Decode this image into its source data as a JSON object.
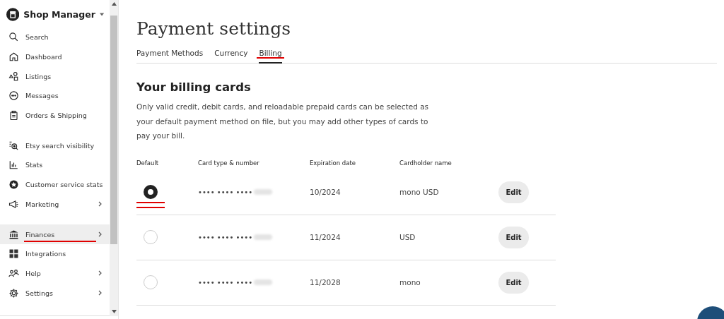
{
  "sidebar": {
    "title": "Shop Manager",
    "groups": [
      {
        "items": [
          {
            "label": "Search",
            "selected": false,
            "expandable": false,
            "marked": false
          },
          {
            "label": "Dashboard",
            "selected": false,
            "expandable": false,
            "marked": false
          },
          {
            "label": "Listings",
            "selected": false,
            "expandable": false,
            "marked": false
          },
          {
            "label": "Messages",
            "selected": false,
            "expandable": false,
            "marked": false
          },
          {
            "label": "Orders & Shipping",
            "selected": false,
            "expandable": false,
            "marked": false
          }
        ]
      },
      {
        "items": [
          {
            "label": "Etsy search visibility",
            "selected": false,
            "expandable": false,
            "marked": false
          },
          {
            "label": "Stats",
            "selected": false,
            "expandable": false,
            "marked": false
          },
          {
            "label": "Customer service stats",
            "selected": false,
            "expandable": false,
            "marked": false
          },
          {
            "label": "Marketing",
            "selected": false,
            "expandable": true,
            "marked": false
          }
        ]
      },
      {
        "items": [
          {
            "label": "Finances",
            "selected": true,
            "expandable": true,
            "marked": true
          },
          {
            "label": "Integrations",
            "selected": false,
            "expandable": false,
            "marked": false
          },
          {
            "label": "Help",
            "selected": false,
            "expandable": true,
            "marked": false
          },
          {
            "label": "Settings",
            "selected": false,
            "expandable": true,
            "marked": false
          }
        ]
      }
    ]
  },
  "page": {
    "title": "Payment settings",
    "tabs": [
      {
        "label": "Payment Methods",
        "selected": false,
        "marked": false
      },
      {
        "label": "Currency",
        "selected": false,
        "marked": false
      },
      {
        "label": "Billing",
        "selected": true,
        "marked": true
      }
    ],
    "heading": "Your billing cards",
    "description": "Only valid credit, debit cards, and reloadable prepaid cards can be selected as your default payment method on file, but you may add other types of cards to pay your bill.",
    "table": {
      "columns": [
        "Default",
        "Card type & number",
        "Expiration date",
        "Cardholder name"
      ],
      "rows": [
        {
          "selected": true,
          "marked": true,
          "card_number": "•••• •••• ••••",
          "expiration": "10/2024",
          "cardholder": "mono USD",
          "action": "Edit"
        },
        {
          "selected": false,
          "marked": false,
          "card_number": "•••• •••• ••••",
          "expiration": "11/2024",
          "cardholder": "USD",
          "action": "Edit"
        },
        {
          "selected": false,
          "marked": false,
          "card_number": "•••• •••• ••••",
          "expiration": "11/2028",
          "cardholder": "mono",
          "action": "Edit"
        }
      ]
    }
  }
}
